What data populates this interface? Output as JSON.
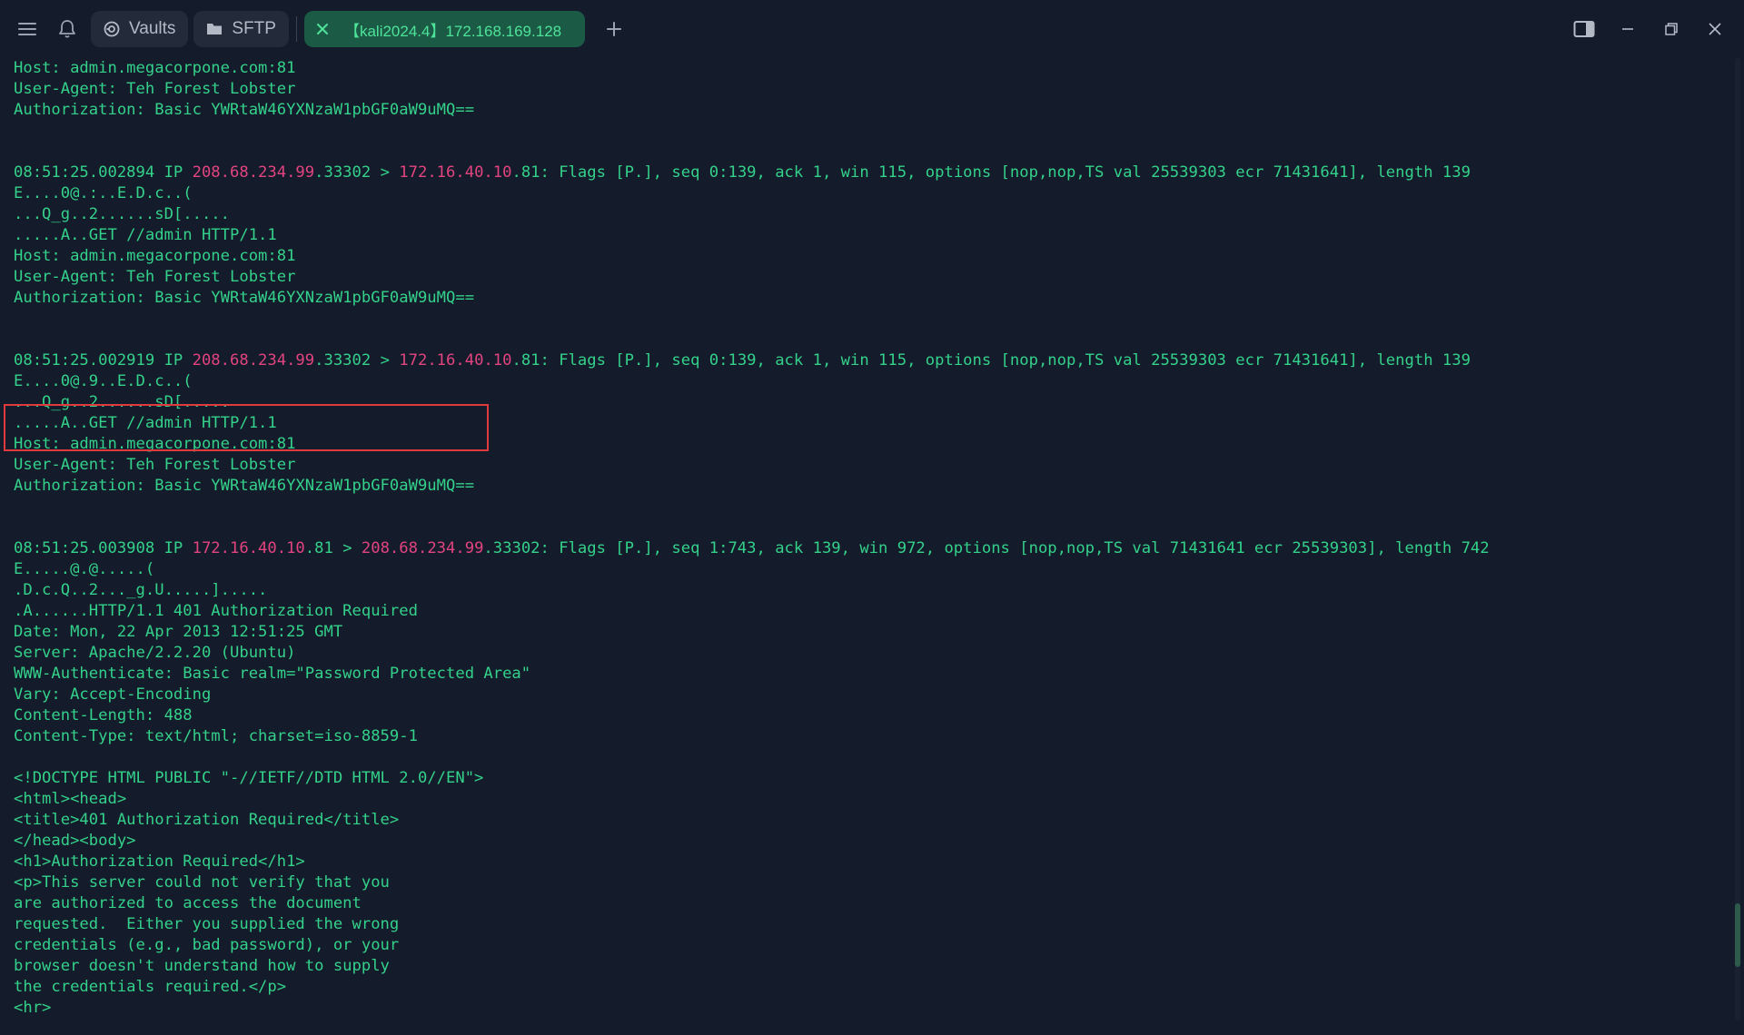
{
  "tabs": {
    "vaults_label": "Vaults",
    "sftp_label": "SFTP",
    "active_label": "【kali2024.4】172.168.169.128"
  },
  "terminal": {
    "lines": [
      [
        {
          "t": "Host: admin.megacorpone.com:81"
        }
      ],
      [
        {
          "t": "User-Agent: Teh Forest Lobster"
        }
      ],
      [
        {
          "t": "Authorization: Basic YWRtaW46YXNzaW1pbGF0aW9uMQ=="
        }
      ],
      [
        {
          "t": ""
        }
      ],
      [
        {
          "t": ""
        }
      ],
      [
        {
          "t": "08:51:25.002894 IP "
        },
        {
          "t": "208.68.234.99",
          "ip": true
        },
        {
          "t": ".33302 > "
        },
        {
          "t": "172.16.40.10",
          "ip": true
        },
        {
          "t": ".81: Flags [P.], seq 0:139, ack 1, win 115, options [nop,nop,TS val 25539303 ecr 71431641], length 139"
        }
      ],
      [
        {
          "t": "E....0@.:..E.D.c..("
        }
      ],
      [
        {
          "t": "...Q_g..2......sD[....."
        }
      ],
      [
        {
          "t": ".....A..GET //admin HTTP/1.1"
        }
      ],
      [
        {
          "t": "Host: admin.megacorpone.com:81"
        }
      ],
      [
        {
          "t": "User-Agent: Teh Forest Lobster"
        }
      ],
      [
        {
          "t": "Authorization: Basic YWRtaW46YXNzaW1pbGF0aW9uMQ=="
        }
      ],
      [
        {
          "t": ""
        }
      ],
      [
        {
          "t": ""
        }
      ],
      [
        {
          "t": "08:51:25.002919 IP "
        },
        {
          "t": "208.68.234.99",
          "ip": true
        },
        {
          "t": ".33302 > "
        },
        {
          "t": "172.16.40.10",
          "ip": true
        },
        {
          "t": ".81: Flags [P.], seq 0:139, ack 1, win 115, options [nop,nop,TS val 25539303 ecr 71431641], length 139"
        }
      ],
      [
        {
          "t": "E....0@.9..E.D.c..("
        }
      ],
      [
        {
          "t": "...Q_g..2......sD[....."
        }
      ],
      [
        {
          "t": ".....A..GET //admin HTTP/1.1"
        }
      ],
      [
        {
          "t": "Host: admin.megacorpone.com:81"
        }
      ],
      [
        {
          "t": "User-Agent: Teh Forest Lobster"
        }
      ],
      [
        {
          "t": "Authorization: Basic YWRtaW46YXNzaW1pbGF0aW9uMQ=="
        }
      ],
      [
        {
          "t": ""
        }
      ],
      [
        {
          "t": ""
        }
      ],
      [
        {
          "t": "08:51:25.003908 IP "
        },
        {
          "t": "172.16.40.10",
          "ip": true
        },
        {
          "t": ".81 > "
        },
        {
          "t": "208.68.234.99",
          "ip": true
        },
        {
          "t": ".33302: Flags [P.], seq 1:743, ack 139, win 972, options [nop,nop,TS val 71431641 ecr 25539303], length 742"
        }
      ],
      [
        {
          "t": "E.....@.@.....("
        }
      ],
      [
        {
          "t": ".D.c.Q..2..._g.U.....]....."
        }
      ],
      [
        {
          "t": ".A......HTTP/1.1 401 Authorization Required"
        }
      ],
      [
        {
          "t": "Date: Mon, 22 Apr 2013 12:51:25 GMT"
        }
      ],
      [
        {
          "t": "Server: Apache/2.2.20 (Ubuntu)"
        }
      ],
      [
        {
          "t": "WWW-Authenticate: Basic realm=\"Password Protected Area\""
        }
      ],
      [
        {
          "t": "Vary: Accept-Encoding"
        }
      ],
      [
        {
          "t": "Content-Length: 488"
        }
      ],
      [
        {
          "t": "Content-Type: text/html; charset=iso-8859-1"
        }
      ],
      [
        {
          "t": ""
        }
      ],
      [
        {
          "t": "<!DOCTYPE HTML PUBLIC \"-//IETF//DTD HTML 2.0//EN\">"
        }
      ],
      [
        {
          "t": "<html><head>"
        }
      ],
      [
        {
          "t": "<title>401 Authorization Required</title>"
        }
      ],
      [
        {
          "t": "</head><body>"
        }
      ],
      [
        {
          "t": "<h1>Authorization Required</h1>"
        }
      ],
      [
        {
          "t": "<p>This server could not verify that you"
        }
      ],
      [
        {
          "t": "are authorized to access the document"
        }
      ],
      [
        {
          "t": "requested.  Either you supplied the wrong"
        }
      ],
      [
        {
          "t": "credentials (e.g., bad password), or your"
        }
      ],
      [
        {
          "t": "browser doesn't understand how to supply"
        }
      ],
      [
        {
          "t": "the credentials required.</p>"
        }
      ],
      [
        {
          "t": "<hr>"
        }
      ]
    ]
  },
  "scroll_position_fraction": 0.94,
  "colors": {
    "background": "#141b2b",
    "text": "#34d18a",
    "ip_highlight": "#e2447f",
    "active_tab_bg": "#1b5a45",
    "highlight_box": "#e03a3e"
  },
  "icons": [
    "menu-icon",
    "bell-icon",
    "vault-icon",
    "folder-icon",
    "close-tab-icon",
    "plus-icon",
    "split-view-icon",
    "minimize-icon",
    "restore-icon",
    "close-window-icon"
  ]
}
